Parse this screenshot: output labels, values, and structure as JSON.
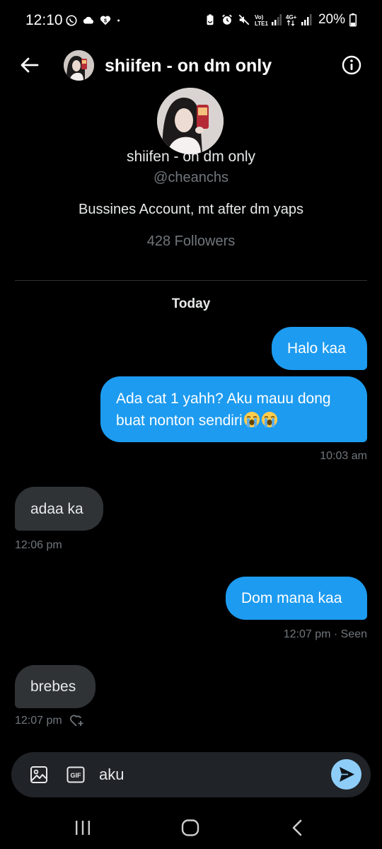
{
  "status_bar": {
    "time": "12:10",
    "battery": "20%",
    "icons": [
      "whatsapp-icon",
      "cloud-icon",
      "dollar-heart-icon",
      "dot-icon",
      "battery-saver-icon",
      "alarm-icon",
      "mute-icon",
      "volte-signal-icon",
      "4g-signal-icon",
      "battery-icon"
    ]
  },
  "header": {
    "title": "shiifen - on dm only"
  },
  "profile": {
    "name": "shiifen - on dm only",
    "handle": "@cheanchs",
    "bio": "Bussines Account, mt after dm yaps",
    "followers": "428 Followers"
  },
  "conversation": {
    "day_label": "Today",
    "messages": [
      {
        "direction": "out",
        "text": "Halo kaa"
      },
      {
        "direction": "out",
        "line1": "Ada cat 1 yahh? Aku mauu dong",
        "line2": "buat nonton sendiri",
        "emoji": "loudly-crying-face-emoji",
        "timestamp": "10:03 am"
      },
      {
        "direction": "in",
        "text": "adaa ka",
        "timestamp": "12:06 pm"
      },
      {
        "direction": "out",
        "text": "Dom mana kaa",
        "timestamp": "12:07 pm · Seen"
      },
      {
        "direction": "in",
        "text": "brebes",
        "timestamp": "12:07 pm"
      }
    ]
  },
  "composer": {
    "value": "aku"
  },
  "colors": {
    "background": "#000000",
    "outgoing_bubble": "#1d9bf0",
    "incoming_bubble": "#2f3336",
    "muted_text": "#71767b",
    "send_button": "#8ecdf8"
  }
}
